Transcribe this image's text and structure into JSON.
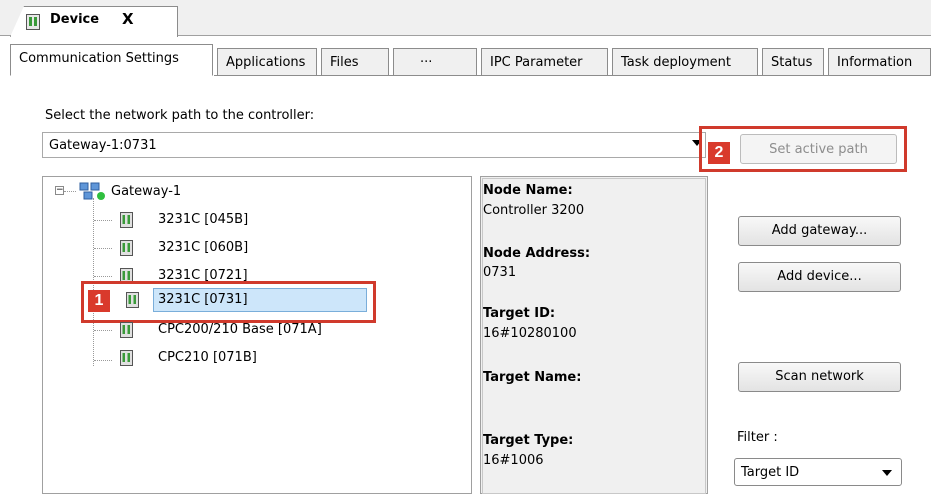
{
  "document_tab": {
    "title": "Device",
    "close": "X"
  },
  "tabs": [
    {
      "label": "Communication Settings",
      "active": true
    },
    {
      "label": "Applications"
    },
    {
      "label": "Files"
    },
    {
      "label": "···"
    },
    {
      "label": "IPC Parameter"
    },
    {
      "label": "Task deployment"
    },
    {
      "label": "Status"
    },
    {
      "label": "Information"
    }
  ],
  "network": {
    "select_label": "Select the network path to the controller:",
    "path_value": "Gateway-1:0731",
    "set_active_label": "Set active path"
  },
  "badges": {
    "one": "1",
    "two": "2"
  },
  "tree": {
    "gateway": "Gateway-1",
    "expander": "−",
    "devices": [
      "3231C [045B]",
      "3231C [060B]",
      "3231C [0721]",
      "3231C [0731]",
      "CPC200/210 Base  [071A]",
      "CPC210 [071B]"
    ],
    "selected_index": 3
  },
  "info": {
    "node_name_label": "Node Name:",
    "node_name_value": "Controller 3200",
    "node_address_label": "Node Address:",
    "node_address_value": "0731",
    "target_id_label": "Target ID:",
    "target_id_value": "16#10280100",
    "target_name_label": "Target Name:",
    "target_type_label": "Target Type:",
    "target_type_value": "16#1006"
  },
  "actions": {
    "add_gateway": "Add gateway...",
    "add_device": "Add device...",
    "scan_network": "Scan network"
  },
  "filter": {
    "label": "Filter :",
    "value": "Target ID"
  },
  "colors": {
    "accent_red": "#d03a2c",
    "selection": "#cde6fa"
  }
}
